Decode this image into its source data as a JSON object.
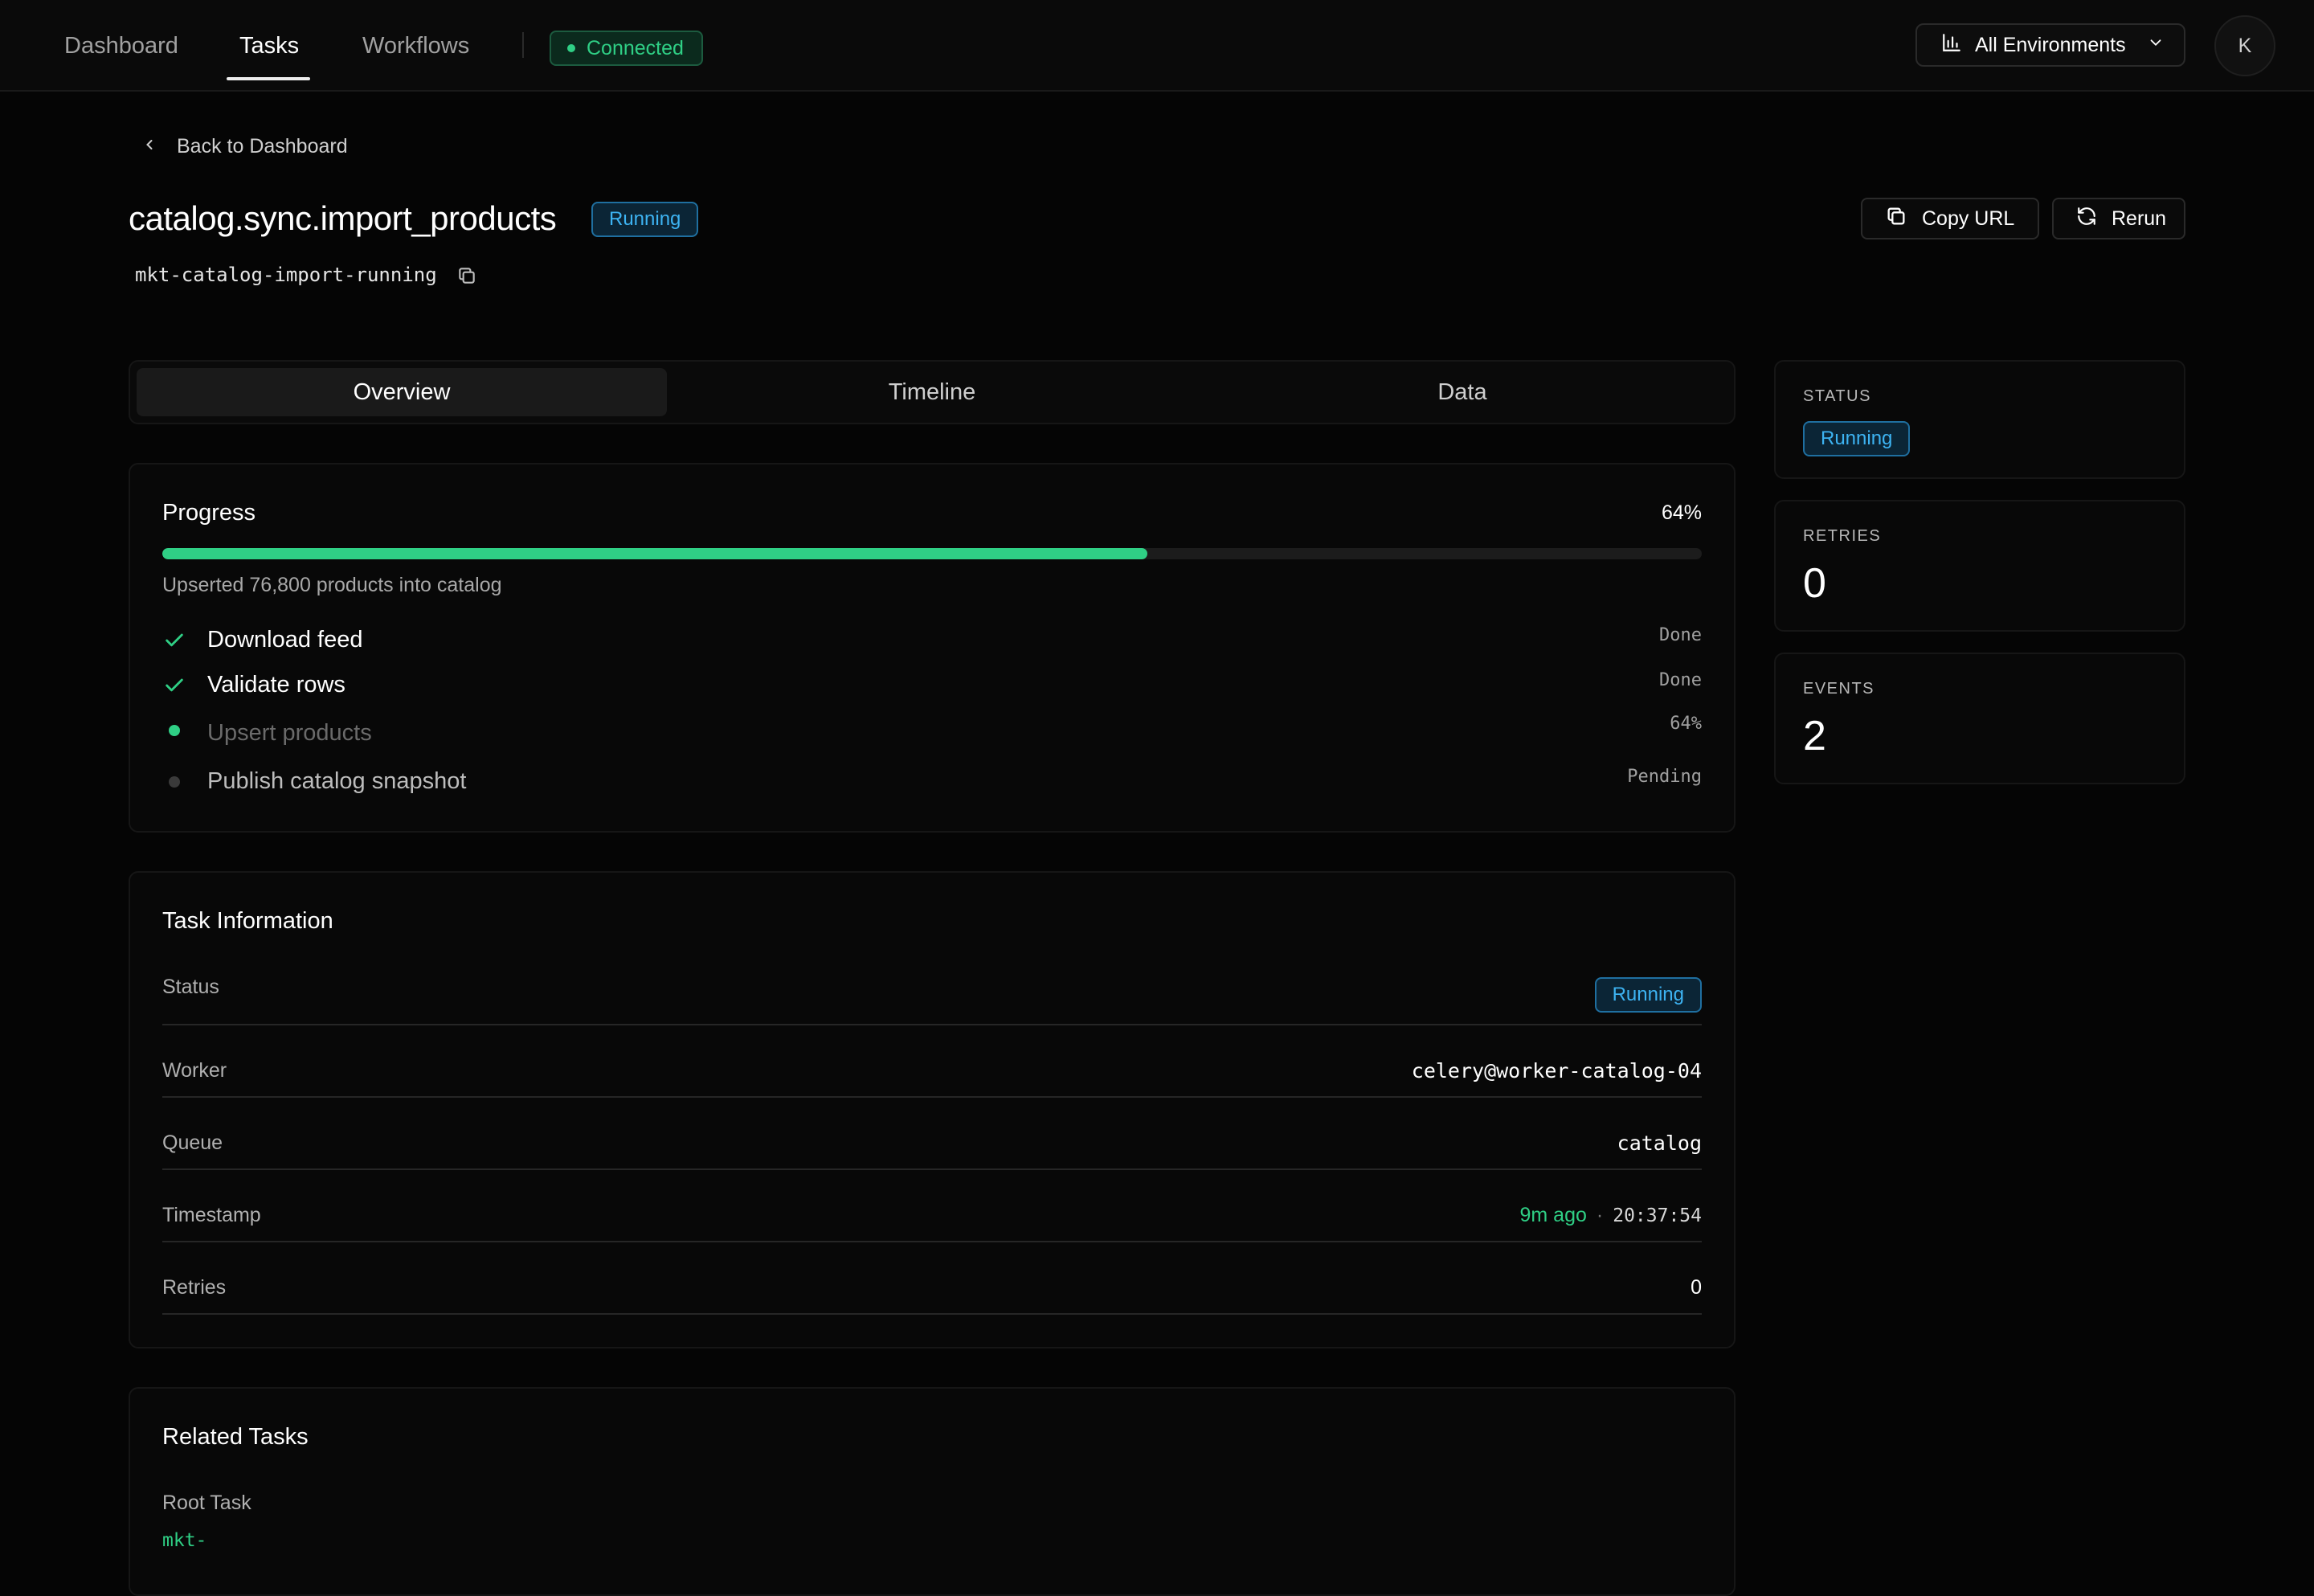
{
  "nav": {
    "tabs": [
      {
        "label": "Dashboard"
      },
      {
        "label": "Tasks"
      },
      {
        "label": "Workflows"
      }
    ],
    "active_tab": "Tasks",
    "connection_status": "Connected",
    "environment_label": "All Environments",
    "avatar_initial": "K"
  },
  "header": {
    "back_label": "Back to Dashboard",
    "task_name": "catalog.sync.import_products",
    "status_badge": "Running",
    "task_id": "mkt-catalog-import-running",
    "copy_url_label": "Copy URL",
    "rerun_label": "Rerun"
  },
  "tabs": [
    {
      "label": "Overview"
    },
    {
      "label": "Timeline"
    },
    {
      "label": "Data"
    }
  ],
  "active_detail_tab": "Overview",
  "progress": {
    "title": "Progress",
    "percent_label": "64%",
    "percent": 0.64,
    "summary": "Upserted 76,800 products into catalog",
    "steps": [
      {
        "label": "Download feed",
        "status": "Done",
        "state": "done"
      },
      {
        "label": "Validate rows",
        "status": "Done",
        "state": "done"
      },
      {
        "label": "Upsert products",
        "status": "64%",
        "state": "active"
      },
      {
        "label": "Publish catalog snapshot",
        "status": "Pending",
        "state": "pending"
      }
    ]
  },
  "task_info": {
    "title": "Task Information",
    "rows": {
      "status": {
        "label": "Status",
        "value": "Running"
      },
      "worker": {
        "label": "Worker",
        "value": "celery@worker-catalog-04"
      },
      "queue": {
        "label": "Queue",
        "value": "catalog"
      },
      "timestamp": {
        "label": "Timestamp",
        "relative": "9m ago",
        "separator": "·",
        "time": "20:37:54"
      },
      "retries": {
        "label": "Retries",
        "value": "0"
      }
    }
  },
  "related": {
    "title": "Related Tasks",
    "root_task_label": "Root Task",
    "root_task_value": "mkt-"
  },
  "stats": {
    "status": {
      "label": "STATUS",
      "value": "Running"
    },
    "retries": {
      "label": "RETRIES",
      "value": "0"
    },
    "events": {
      "label": "EVENTS",
      "value": "2"
    }
  },
  "colors": {
    "accent_green": "#2fcf85",
    "running_blue": "#3db3f2",
    "background": "#050505"
  }
}
